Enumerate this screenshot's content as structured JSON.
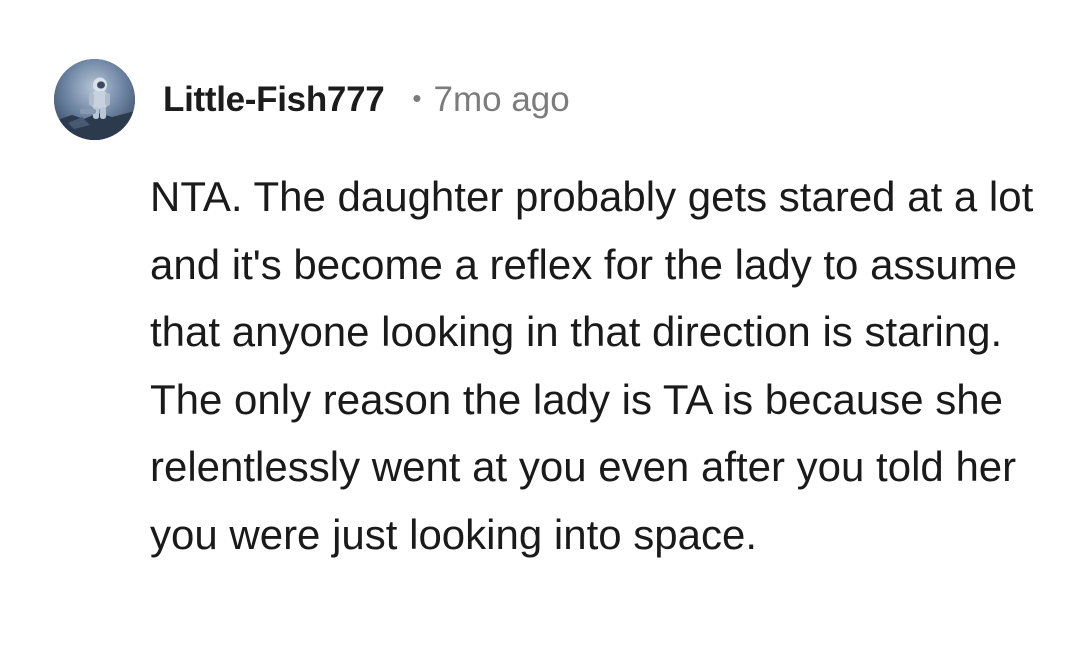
{
  "comment": {
    "author": "Little-Fish777",
    "separator": "•",
    "timestamp": "7mo ago",
    "avatar_icon": "astronaut-avatar-icon",
    "body": "NTA. The daughter probably gets stared at a lot and it's become a reflex for the lady to assume that anyone looking in that direction is staring. The only reason the lady is TA is because she relentlessly went at you even after you told her you were just looking into space."
  },
  "colors": {
    "background": "#ffffff",
    "text": "#1a1a1b",
    "meta": "#7c7c7c"
  }
}
